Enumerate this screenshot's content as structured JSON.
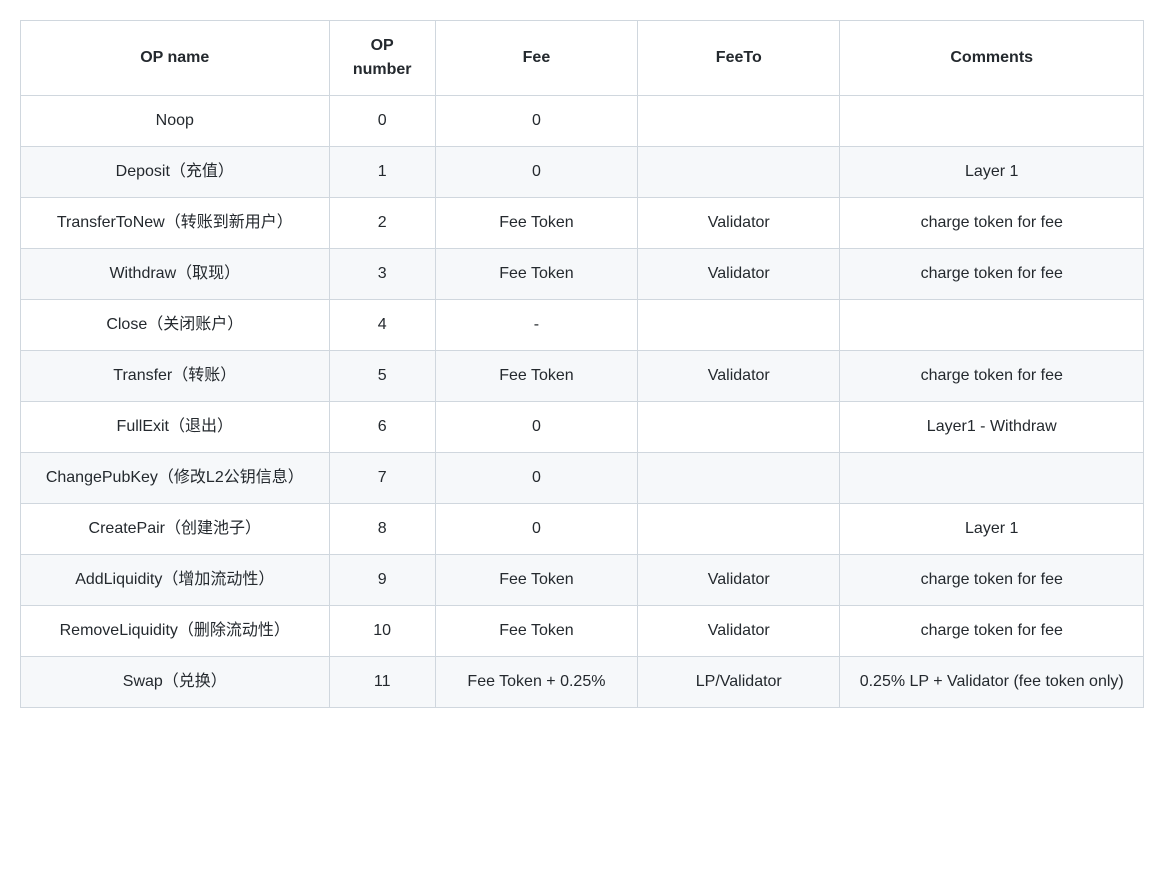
{
  "table": {
    "headers": {
      "op_name": "OP name",
      "op_number": "OP number",
      "fee": "Fee",
      "fee_to": "FeeTo",
      "comments": "Comments"
    },
    "rows": [
      {
        "op_name": "Noop",
        "op_number": "0",
        "fee": "0",
        "fee_to": "",
        "comments": ""
      },
      {
        "op_name": "Deposit（充值）",
        "op_number": "1",
        "fee": "0",
        "fee_to": "",
        "comments": "Layer 1"
      },
      {
        "op_name": "TransferToNew（转账到新用户）",
        "op_number": "2",
        "fee": "Fee Token",
        "fee_to": "Validator",
        "comments": "charge token for fee"
      },
      {
        "op_name": "Withdraw（取现）",
        "op_number": "3",
        "fee": "Fee Token",
        "fee_to": "Validator",
        "comments": "charge token for fee"
      },
      {
        "op_name": "Close（关闭账户）",
        "op_number": "4",
        "fee": "-",
        "fee_to": "",
        "comments": ""
      },
      {
        "op_name": "Transfer（转账）",
        "op_number": "5",
        "fee": "Fee Token",
        "fee_to": "Validator",
        "comments": "charge token for fee"
      },
      {
        "op_name": "FullExit（退出）",
        "op_number": "6",
        "fee": "0",
        "fee_to": "",
        "comments": "Layer1 - Withdraw"
      },
      {
        "op_name": "ChangePubKey（修改L2公钥信息）",
        "op_number": "7",
        "fee": "0",
        "fee_to": "",
        "comments": ""
      },
      {
        "op_name": "CreatePair（创建池子）",
        "op_number": "8",
        "fee": "0",
        "fee_to": "",
        "comments": "Layer 1"
      },
      {
        "op_name": "AddLiquidity（增加流动性）",
        "op_number": "9",
        "fee": "Fee Token",
        "fee_to": "Validator",
        "comments": "charge token for fee"
      },
      {
        "op_name": "RemoveLiquidity（删除流动性）",
        "op_number": "10",
        "fee": "Fee Token",
        "fee_to": "Validator",
        "comments": "charge token for fee"
      },
      {
        "op_name": "Swap（兑换）",
        "op_number": "11",
        "fee": "Fee Token + 0.25%",
        "fee_to": "LP/Validator",
        "comments": "0.25% LP + Validator (fee token only)"
      }
    ]
  }
}
